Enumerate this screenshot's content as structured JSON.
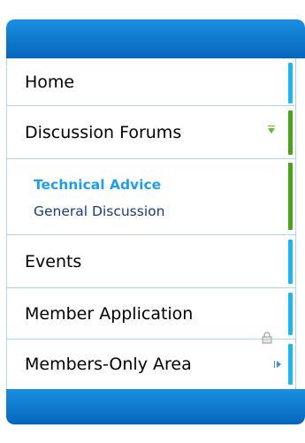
{
  "menu": {
    "items": [
      {
        "label": "Home",
        "accent": "#1fb6ef"
      },
      {
        "label": "Discussion Forums",
        "accent": "#4aa31a",
        "expanded": true,
        "icon": "chevron-down-icon"
      },
      {
        "label": "Events",
        "accent": "#1fb6ef"
      },
      {
        "label": "Member Application",
        "accent": "#1fb6ef"
      },
      {
        "label": "Members-Only Area",
        "accent": "#1fb6ef",
        "icon": "lock-icon"
      }
    ],
    "submenu": [
      {
        "label": "Technical Advice",
        "active": true
      },
      {
        "label": "General Discussion",
        "active": false
      }
    ]
  },
  "colors": {
    "bar": "#0a73cf",
    "border": "#a8d8ef",
    "active_sub": "#1f9ee8",
    "sub": "#1a3a7d"
  }
}
